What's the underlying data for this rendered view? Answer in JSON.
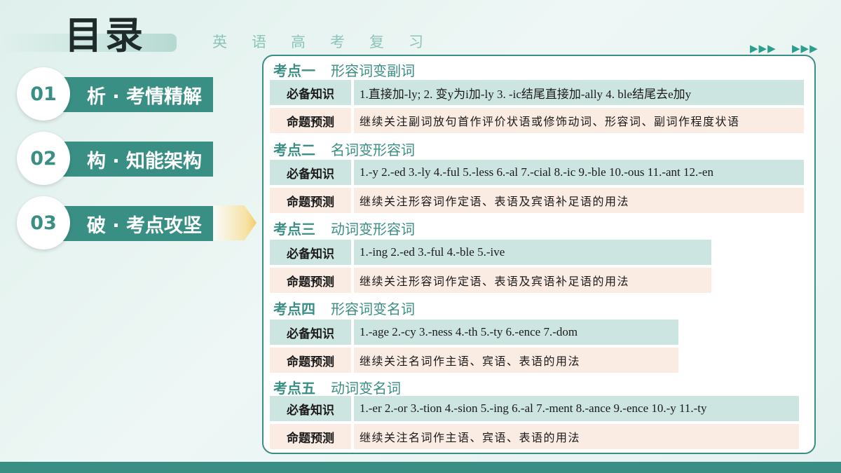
{
  "header": {
    "title": "目录",
    "subtitle": "英语高考复习",
    "arrows_left": "▶▶▶",
    "arrows_right": "▶▶▶"
  },
  "nav": [
    {
      "num": "01",
      "label": "析 · 考情精解"
    },
    {
      "num": "02",
      "label": "构 · 知能架构"
    },
    {
      "num": "03",
      "label": "破 · 考点攻坚"
    }
  ],
  "sections": [
    {
      "kaodian": "考点一",
      "topic": "形容词变副词",
      "knowledge_label": "必备知识",
      "knowledge": "1.直接加-ly; 2. 变y为i加-ly 3. -ic结尾直接加-ally 4. ble结尾去e加y",
      "prediction_label": "命题预测",
      "prediction": "继续关注副词放句首作评价状语或修饰动词、形容词、副词作程度状语"
    },
    {
      "kaodian": "考点二",
      "topic": "名词变形容词",
      "knowledge_label": "必备知识",
      "knowledge": "1.-y 2.-ed 3.-ly 4.-ful 5.-less 6.-al 7.-cial 8.-ic 9.-ble 10.-ous 11.-ant 12.-en",
      "prediction_label": "命题预测",
      "prediction": "继续关注形容词作定语、表语及宾语补足语的用法"
    },
    {
      "kaodian": "考点三",
      "topic": "动词变形容词",
      "knowledge_label": "必备知识",
      "knowledge": "1.-ing 2.-ed 3.-ful 4.-ble 5.-ive",
      "prediction_label": "命题预测",
      "prediction": "继续关注形容词作定语、表语及宾语补足语的用法"
    },
    {
      "kaodian": "考点四",
      "topic": "形容词变名词",
      "knowledge_label": "必备知识",
      "knowledge": "1.-age 2.-cy 3.-ness 4.-th 5.-ty 6.-ence 7.-dom",
      "prediction_label": "命题预测",
      "prediction": "继续关注名词作主语、宾语、表语的用法"
    },
    {
      "kaodian": "考点五",
      "topic": "动词变名词",
      "knowledge_label": "必备知识",
      "knowledge": "1.-er 2.-or 3.-tion 4.-sion 5.-ing 6.-al 7.-ment 8.-ance 9.-ence 10.-y 11.-ty",
      "prediction_label": "命题预测",
      "prediction": "继续关注名词作主语、宾语、表语的用法"
    }
  ],
  "colors": {
    "accent": "#3a8f84",
    "knowledge_bg": "#cde5e0",
    "prediction_bg": "#fbece3",
    "highlight": "#f2cd6a"
  }
}
